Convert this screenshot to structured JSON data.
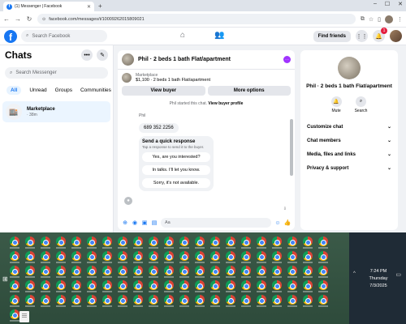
{
  "browser": {
    "tab_title": "(1) Messenger | Facebook",
    "tab_close": "✕",
    "new_tab": "+",
    "window_controls": [
      "–",
      "☐",
      "✕"
    ],
    "url": "facebook.com/messages/t/10009262015809021",
    "nav": {
      "back": "←",
      "forward": "→",
      "reload": "↻"
    }
  },
  "fb": {
    "logo": "f",
    "search_placeholder": "Search Facebook",
    "find_friends": "Find friends",
    "notif_count": "1"
  },
  "chats": {
    "title": "Chats",
    "search_placeholder": "Search Messenger",
    "filters": [
      "All",
      "Unread",
      "Groups",
      "Communities"
    ],
    "conversation": {
      "name": "Marketplace",
      "time": "· 38m"
    }
  },
  "thread": {
    "title": "Phil · 2 beds 1 bath Flat/apartment",
    "listing_source": "Marketplace",
    "listing_desc": "$1,100 · 2 beds 1 bath Flat/apartment",
    "view_buyer": "View buyer",
    "more_options": "More options",
    "system_msg_prefix": "Phil started this chat.",
    "system_msg_link": "View buyer profile",
    "sender": "Phil",
    "phone": "689 352 2256",
    "quick_title": "Send a quick response",
    "quick_sub": "Tap a response to send it to the buyer.",
    "quick_replies": [
      "Yes, are you interested?",
      "In talks. I'll let you know.",
      "Sorry, it's not available."
    ],
    "composer_placeholder": "Aa"
  },
  "info": {
    "name": "Phil · 2 beds 1 bath Flat/apartment",
    "mute": "Mute",
    "search": "Search",
    "sections": [
      "Customize chat",
      "Chat members",
      "Media, files and links",
      "Privacy & support"
    ]
  },
  "taskbar": {
    "time": "7:24 PM",
    "day": "Thursday",
    "date": "7/3/2025",
    "up_arrow": "^"
  },
  "colors": {
    "brand": "#1877f2",
    "accent_purple": "#a033ff",
    "badge_red": "#e41e3f"
  }
}
